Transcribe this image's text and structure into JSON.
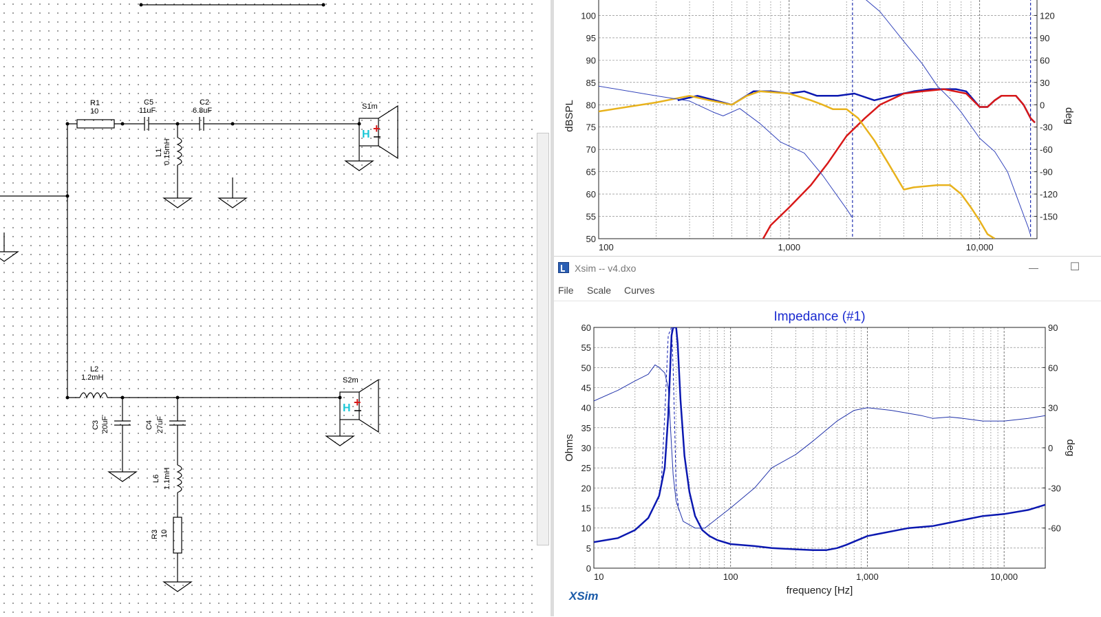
{
  "schematic": {
    "components": [
      {
        "ref": "R1",
        "value": "10"
      },
      {
        "ref": "C5",
        "value": "11uF"
      },
      {
        "ref": "C2",
        "value": "6.8uF"
      },
      {
        "ref": "L1",
        "value": "0.15mH"
      },
      {
        "ref": "S1m",
        "value": ""
      },
      {
        "ref": "L2",
        "value": "1.2mH"
      },
      {
        "ref": "C3",
        "value": "20uF"
      },
      {
        "ref": "C4",
        "value": "27uF"
      },
      {
        "ref": "L6",
        "value": "1.1mH"
      },
      {
        "ref": "R3",
        "value": "10"
      },
      {
        "ref": "S2m",
        "value": ""
      }
    ],
    "speaker_h_label": "H"
  },
  "window": {
    "title": "Xsim -- v4.dxo",
    "menu": [
      "File",
      "Scale",
      "Curves"
    ],
    "minimize_glyph": "—",
    "maximize_glyph": "☐",
    "brand": "XSim"
  },
  "chart_data": [
    {
      "type": "line",
      "title": "",
      "xlabel": "",
      "ylabel": "dBSPL",
      "y2label": "deg",
      "xscale": "log",
      "xlim": [
        100,
        20000
      ],
      "ylim": [
        50,
        105
      ],
      "y2lim": [
        -180,
        150
      ],
      "x_ticks": [
        100,
        1000,
        10000
      ],
      "x_tick_labels": [
        "100",
        "1,000",
        "10,000"
      ],
      "y_ticks": [
        50,
        55,
        60,
        65,
        70,
        75,
        80,
        85,
        90,
        95,
        100
      ],
      "y_tick_labels": [
        "50",
        "55",
        "60",
        "65",
        "70",
        "75",
        "80",
        "85",
        "90",
        "95",
        "100"
      ],
      "y2_ticks": [
        -150,
        -120,
        -90,
        -60,
        -30,
        0,
        30,
        60,
        90,
        120
      ],
      "y2_tick_labels": [
        "-150",
        "-120",
        "-90",
        "-60",
        "-30",
        "0",
        "30",
        "60",
        "90",
        "120"
      ],
      "grid": true,
      "series": [
        {
          "color": "#0b18b0",
          "axis": "left",
          "width": 2.5,
          "points": [
            [
              260,
              81
            ],
            [
              330,
              82
            ],
            [
              500,
              80
            ],
            [
              650,
              83
            ],
            [
              800,
              83
            ],
            [
              1000,
              82.5
            ],
            [
              1200,
              83
            ],
            [
              1400,
              82
            ],
            [
              1800,
              82
            ],
            [
              2200,
              82.5
            ],
            [
              2800,
              81
            ],
            [
              3500,
              82
            ],
            [
              4500,
              83
            ],
            [
              5500,
              83.5
            ],
            [
              6500,
              83.5
            ],
            [
              7500,
              83.5
            ],
            [
              8500,
              83
            ],
            [
              10000,
              79.5
            ],
            [
              11000,
              79.5
            ],
            [
              12000,
              81
            ],
            [
              13000,
              82
            ],
            [
              15500,
              82
            ],
            [
              17000,
              80
            ],
            [
              18500,
              77
            ],
            [
              19500,
              76
            ]
          ]
        },
        {
          "color": "#d81818",
          "axis": "left",
          "width": 2.5,
          "points": [
            [
              730,
              50
            ],
            [
              800,
              53
            ],
            [
              1000,
              57
            ],
            [
              1300,
              62
            ],
            [
              1600,
              67
            ],
            [
              2000,
              73
            ],
            [
              2500,
              77
            ],
            [
              3000,
              80
            ],
            [
              4000,
              82.5
            ],
            [
              5000,
              83
            ],
            [
              6500,
              83.5
            ],
            [
              8500,
              82.5
            ],
            [
              10000,
              79.5
            ],
            [
              11000,
              79.5
            ],
            [
              12000,
              81
            ],
            [
              13000,
              82
            ],
            [
              15500,
              82
            ],
            [
              17000,
              80
            ],
            [
              18500,
              77
            ],
            [
              19500,
              76
            ]
          ]
        },
        {
          "color": "#e8b21c",
          "axis": "left",
          "width": 2.5,
          "points": [
            [
              100,
              78.5
            ],
            [
              200,
              80.5
            ],
            [
              300,
              82
            ],
            [
              380,
              81
            ],
            [
              500,
              80
            ],
            [
              600,
              82
            ],
            [
              700,
              83
            ],
            [
              1000,
              82.5
            ],
            [
              1300,
              81
            ],
            [
              1500,
              80
            ],
            [
              1700,
              79
            ],
            [
              2000,
              79
            ],
            [
              2300,
              77
            ],
            [
              2800,
              72
            ],
            [
              3300,
              67
            ],
            [
              4000,
              61
            ],
            [
              4500,
              61.5
            ],
            [
              6000,
              62
            ],
            [
              7000,
              62
            ],
            [
              8000,
              60
            ],
            [
              9000,
              57
            ],
            [
              10000,
              54
            ],
            [
              11000,
              51
            ],
            [
              12000,
              50
            ]
          ]
        },
        {
          "color": "#3344bb",
          "axis": "right",
          "width": 1,
          "points": [
            [
              100,
              25
            ],
            [
              200,
              12
            ],
            [
              300,
              5
            ],
            [
              400,
              -10
            ],
            [
              450,
              -15
            ],
            [
              550,
              -5
            ],
            [
              700,
              -25
            ],
            [
              900,
              -50
            ],
            [
              1200,
              -65
            ],
            [
              1500,
              -95
            ],
            [
              2000,
              -140
            ],
            [
              2150,
              -152
            ]
          ]
        },
        {
          "color": "#3344bb",
          "axis": "right",
          "width": 1,
          "points": [
            [
              2300,
              150
            ],
            [
              3000,
              125
            ],
            [
              4000,
              85
            ],
            [
              5000,
              55
            ],
            [
              6000,
              25
            ],
            [
              7000,
              8
            ],
            [
              8000,
              -10
            ],
            [
              10000,
              -45
            ],
            [
              12000,
              -63
            ],
            [
              14000,
              -90
            ],
            [
              16000,
              -130
            ],
            [
              18000,
              -165
            ],
            [
              18500,
              -175
            ]
          ]
        }
      ],
      "markers": [
        2150,
        18500
      ]
    },
    {
      "type": "line",
      "title": "Impedance (#1)",
      "xlabel": "frequency [Hz]",
      "ylabel": "Ohms",
      "y2label": "deg",
      "xscale": "log",
      "xlim": [
        10,
        20000
      ],
      "ylim": [
        0,
        60
      ],
      "y2lim": [
        -90,
        90
      ],
      "x_ticks": [
        10,
        100,
        1000,
        10000
      ],
      "x_tick_labels": [
        "10",
        "100",
        "1,000",
        "10,000"
      ],
      "y_ticks": [
        0,
        5,
        10,
        15,
        20,
        25,
        30,
        35,
        40,
        45,
        50,
        55,
        60
      ],
      "y_tick_labels": [
        "0",
        "5",
        "10",
        "15",
        "20",
        "25",
        "30",
        "35",
        "40",
        "45",
        "50",
        "55",
        "60"
      ],
      "y2_ticks": [
        -60,
        -30,
        0,
        30,
        60,
        90
      ],
      "y2_tick_labels": [
        "-60",
        "-30",
        "0",
        "30",
        "60",
        "90"
      ],
      "grid": true,
      "series": [
        {
          "color": "#0b18b0",
          "axis": "left",
          "width": 2.5,
          "points": [
            [
              10,
              6.5
            ],
            [
              15,
              7.5
            ],
            [
              20,
              9.5
            ],
            [
              25,
              12.5
            ],
            [
              30,
              18
            ],
            [
              33,
              25
            ],
            [
              35,
              38
            ],
            [
              37,
              58
            ],
            [
              38,
              60
            ],
            [
              40,
              60
            ],
            [
              41,
              56
            ],
            [
              43,
              42
            ],
            [
              46,
              28
            ],
            [
              50,
              19
            ],
            [
              55,
              13
            ],
            [
              62,
              9.5
            ],
            [
              70,
              8
            ],
            [
              80,
              7
            ],
            [
              100,
              6
            ],
            [
              150,
              5.5
            ],
            [
              200,
              5
            ],
            [
              300,
              4.7
            ],
            [
              400,
              4.5
            ],
            [
              500,
              4.5
            ],
            [
              600,
              5
            ],
            [
              700,
              5.8
            ],
            [
              1000,
              8
            ],
            [
              2000,
              10
            ],
            [
              3000,
              10.5
            ],
            [
              5000,
              12
            ],
            [
              7000,
              13
            ],
            [
              10000,
              13.5
            ],
            [
              15000,
              14.5
            ],
            [
              20000,
              15.8
            ]
          ]
        },
        {
          "color": "#0b18b0",
          "axis": "left",
          "width": 1,
          "dashed": true,
          "points": [
            [
              31,
              20
            ],
            [
              33,
              38
            ],
            [
              35,
              58
            ],
            [
              37,
              60
            ],
            [
              38,
              50
            ],
            [
              39,
              35
            ],
            [
              40,
              20
            ],
            [
              42,
              14
            ]
          ]
        },
        {
          "color": "#2233aa",
          "axis": "right",
          "width": 1,
          "points": [
            [
              10,
              35
            ],
            [
              15,
              43
            ],
            [
              20,
              50
            ],
            [
              25,
              55
            ],
            [
              28,
              62
            ],
            [
              30,
              60
            ],
            [
              33,
              56
            ],
            [
              35,
              45
            ],
            [
              38,
              -20
            ],
            [
              40,
              -40
            ],
            [
              45,
              -55
            ],
            [
              55,
              -60
            ],
            [
              65,
              -60
            ],
            [
              75,
              -55
            ],
            [
              100,
              -45
            ],
            [
              150,
              -30
            ],
            [
              200,
              -15
            ],
            [
              300,
              -5
            ],
            [
              400,
              5
            ],
            [
              600,
              20
            ],
            [
              800,
              28
            ],
            [
              1000,
              30
            ],
            [
              1500,
              28
            ],
            [
              2500,
              24
            ],
            [
              3000,
              22
            ],
            [
              4000,
              23
            ],
            [
              5000,
              22
            ],
            [
              7000,
              20
            ],
            [
              10000,
              20
            ],
            [
              15000,
              22
            ],
            [
              20000,
              24
            ]
          ]
        }
      ]
    }
  ]
}
